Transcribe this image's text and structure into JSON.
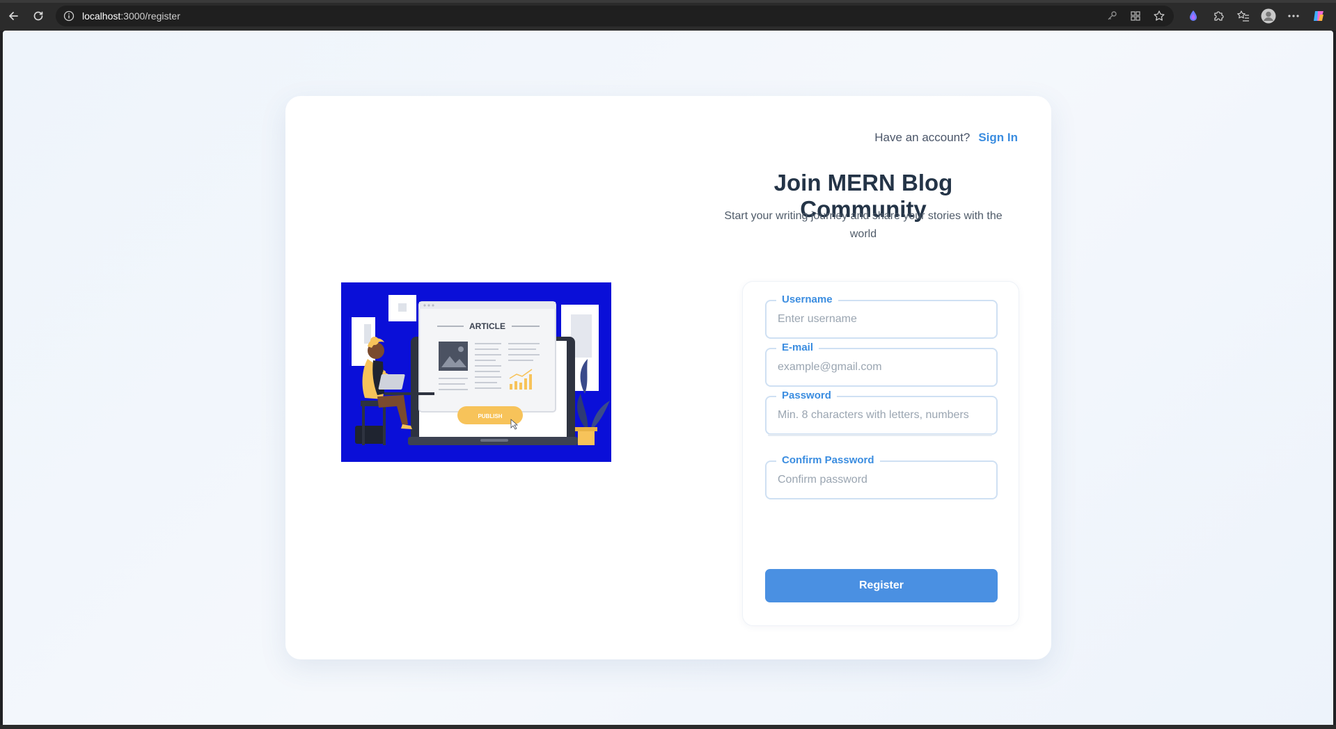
{
  "browser": {
    "url_host": "localhost",
    "url_path": ":3000/register"
  },
  "header": {
    "have_account_text": "Have an account?",
    "signin_label": "Sign In"
  },
  "hero": {
    "title": "Join MERN Blog Community",
    "subtitle": "Start your writing journey and share your stories with the world"
  },
  "illustration": {
    "article_text": "ARTICLE",
    "publish_text": "PUBLISH"
  },
  "form": {
    "username": {
      "label": "Username",
      "placeholder": "Enter username",
      "value": ""
    },
    "email": {
      "label": "E-mail",
      "placeholder": "example@gmail.com",
      "value": ""
    },
    "password": {
      "label": "Password",
      "placeholder": "Min. 8 characters with letters, numbers",
      "value": ""
    },
    "confirm_password": {
      "label": "Confirm Password",
      "placeholder": "Confirm password",
      "value": ""
    },
    "submit_label": "Register"
  },
  "colors": {
    "accent": "#4a90e2",
    "link": "#3b8de0",
    "title": "#243447",
    "illustration_bg": "#0a0fd8",
    "illustration_highlight": "#f7c35a"
  }
}
